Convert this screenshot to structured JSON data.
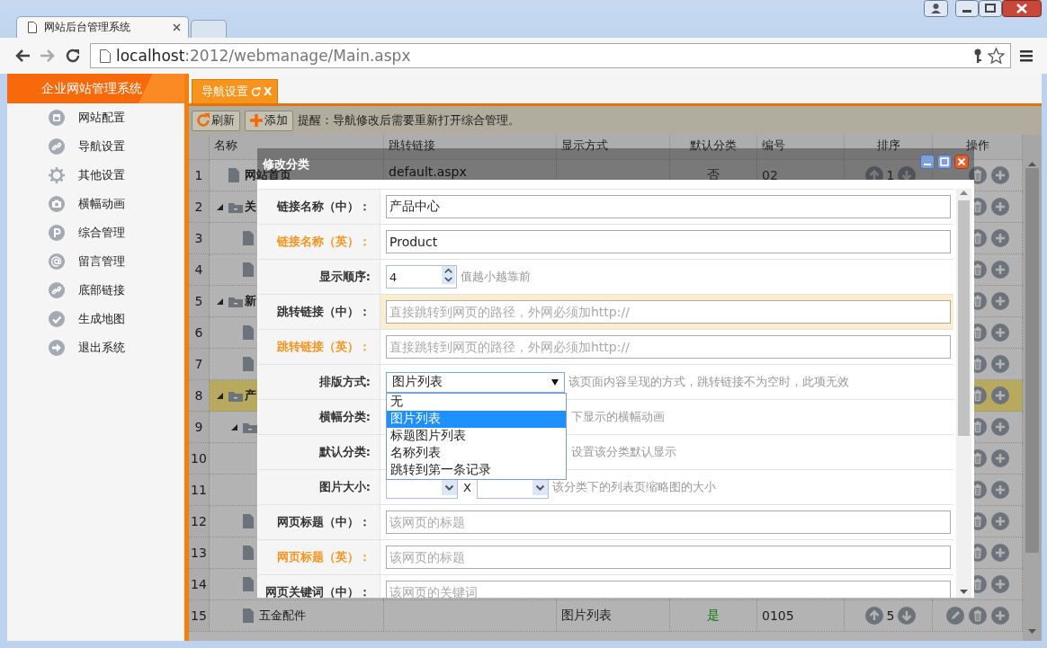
{
  "browser": {
    "tabs": [
      {
        "title": "网站后台管理系统",
        "selected": true
      },
      {
        "selected": false
      }
    ],
    "address": {
      "host": "localhost",
      "rest": ":2012/webmanage/Main.aspx"
    }
  },
  "sidebar": {
    "title": "企业网站管理系统",
    "items": [
      {
        "label": "网站配置",
        "kind": "window"
      },
      {
        "label": "导航设置",
        "kind": "link"
      },
      {
        "label": "其他设置",
        "kind": "gear"
      },
      {
        "label": "横幅动画",
        "kind": "camera"
      },
      {
        "label": "综合管理",
        "kind": "parking"
      },
      {
        "label": "留言管理",
        "kind": "at"
      },
      {
        "label": "底部链接",
        "kind": "link"
      },
      {
        "label": "生成地图",
        "kind": "check"
      },
      {
        "label": "退出系统",
        "kind": "exit"
      }
    ]
  },
  "tabs": [
    {
      "label": "导航设置",
      "selected": true,
      "close": "X"
    }
  ],
  "toolbar": {
    "buttons": [
      {
        "label": "刷新",
        "kind": "refresh"
      },
      {
        "label": "添加",
        "kind": "add"
      }
    ],
    "notice": "提醒：导航修改后需要重新打开综合管理。"
  },
  "table": {
    "columns": [
      "名称",
      "跳转链接",
      "显示方式",
      "默认分类",
      "编号",
      "排序",
      "操作"
    ],
    "rows": [
      {
        "no": "1",
        "kind": "page",
        "name": "网站首页",
        "link": "default.aspx",
        "default": "否",
        "is_default": false,
        "code": "02",
        "order": "1",
        "selected": false,
        "actions": [
          {
            "kind": "delete"
          },
          {
            "kind": "add"
          }
        ]
      },
      {
        "no": "2",
        "kind": "folder",
        "name": "关",
        "selected": false,
        "actions": [
          {
            "kind": "delete"
          },
          {
            "kind": "add"
          }
        ],
        "children": [
          {
            "no": "3",
            "kind": "page",
            "selected": false,
            "actions": [
              {
                "kind": "delete"
              },
              {
                "kind": "add"
              }
            ]
          },
          {
            "no": "4",
            "kind": "page",
            "selected": false,
            "actions": [
              {
                "kind": "delete"
              },
              {
                "kind": "add"
              }
            ]
          }
        ]
      },
      {
        "no": "5",
        "kind": "folder",
        "name": "新",
        "selected": false,
        "actions": [
          {
            "kind": "delete"
          },
          {
            "kind": "add"
          }
        ],
        "children": [
          {
            "no": "6",
            "kind": "page",
            "selected": false,
            "actions": [
              {
                "kind": "delete"
              },
              {
                "kind": "add"
              }
            ]
          },
          {
            "no": "7",
            "kind": "page",
            "selected": false,
            "actions": [
              {
                "kind": "delete"
              },
              {
                "kind": "add"
              }
            ]
          }
        ]
      },
      {
        "no": "8",
        "kind": "folder",
        "name": "产",
        "selected": true,
        "actions": [
          {
            "kind": "delete"
          },
          {
            "kind": "add"
          }
        ],
        "children": [
          {
            "no": "9",
            "kind": "folder",
            "selected": false,
            "actions": [
              {
                "kind": "delete"
              },
              {
                "kind": "add"
              }
            ],
            "children": [
              {
                "no": "10",
                "selected": false,
                "actions": [
                  {
                    "kind": "delete"
                  },
                  {
                    "kind": "add"
                  }
                ]
              },
              {
                "no": "11",
                "selected": false,
                "actions": [
                  {
                    "kind": "delete"
                  },
                  {
                    "kind": "add"
                  }
                ]
              }
            ]
          },
          {
            "no": "12",
            "kind": "page",
            "selected": false,
            "actions": [
              {
                "kind": "delete"
              },
              {
                "kind": "add"
              }
            ]
          },
          {
            "no": "13",
            "kind": "page",
            "selected": false,
            "actions": [
              {
                "kind": "delete"
              },
              {
                "kind": "add"
              }
            ]
          },
          {
            "no": "14",
            "kind": "page",
            "selected": false,
            "actions": [
              {
                "kind": "delete"
              },
              {
                "kind": "add"
              }
            ]
          },
          {
            "no": "15",
            "kind": "page",
            "name": "五金配件",
            "display": "图片列表",
            "default": "是",
            "is_default": true,
            "code": "0105",
            "order": "5",
            "selected": false,
            "actions": [
              {
                "kind": "edit"
              },
              {
                "kind": "delete"
              },
              {
                "kind": "add"
              }
            ]
          }
        ]
      }
    ]
  },
  "dialog": {
    "title": "修改分类",
    "fields": [
      {
        "label": "链接名称（中）：",
        "kind": "text",
        "value": "产品中心",
        "accent": false,
        "highlighted": false
      },
      {
        "label": "链接名称（英）：",
        "kind": "text",
        "value": "Product",
        "accent": true,
        "highlighted": false
      },
      {
        "label": "显示顺序:",
        "kind": "number",
        "value": "4",
        "hint": "值越小越靠前",
        "accent": false,
        "highlighted": false
      },
      {
        "label": "跳转链接（中）：",
        "kind": "text",
        "placeholder": "直接跳转到网页的路径，外网必须加http://",
        "accent": false,
        "highlighted": true
      },
      {
        "label": "跳转链接（英）：",
        "kind": "text",
        "placeholder": "直接跳转到网页的路径，外网必须加http://",
        "accent": true,
        "highlighted": false
      },
      {
        "label": "排版方式:",
        "kind": "select",
        "value": "图片列表",
        "hint": "该页面内容呈现的方式，跳转链接不为空时，此项无效",
        "expanded": true,
        "accent": false,
        "highlighted": false,
        "options": [
          {
            "label": "无",
            "selected": false
          },
          {
            "label": "图片列表",
            "selected": true
          },
          {
            "label": "标题图片列表",
            "selected": false
          },
          {
            "label": "名称列表",
            "selected": false
          },
          {
            "label": "跳转到第一条记录",
            "selected": false
          }
        ]
      },
      {
        "label": "横幅分类:",
        "kind": "hint_only",
        "hint": "下显示的横幅动画",
        "accent": false,
        "highlighted": false
      },
      {
        "label": "默认分类:",
        "kind": "hint_only",
        "hint": "设置该分类默认显示",
        "accent": false,
        "highlighted": false
      },
      {
        "label": "图片大小:",
        "kind": "size",
        "separator": "X",
        "hint": "该分类下的列表页缩略图的大小",
        "accent": false,
        "highlighted": false
      },
      {
        "label": "网页标题（中）：",
        "kind": "text",
        "placeholder": "该网页的标题",
        "accent": false,
        "highlighted": false
      },
      {
        "label": "网页标题（英）：",
        "kind": "text",
        "placeholder": "该网页的标题",
        "accent": true,
        "highlighted": false
      },
      {
        "label": "网页关键词（中）：",
        "kind": "text",
        "placeholder": "该网页的关键词",
        "accent": false,
        "highlighted": false
      }
    ]
  }
}
